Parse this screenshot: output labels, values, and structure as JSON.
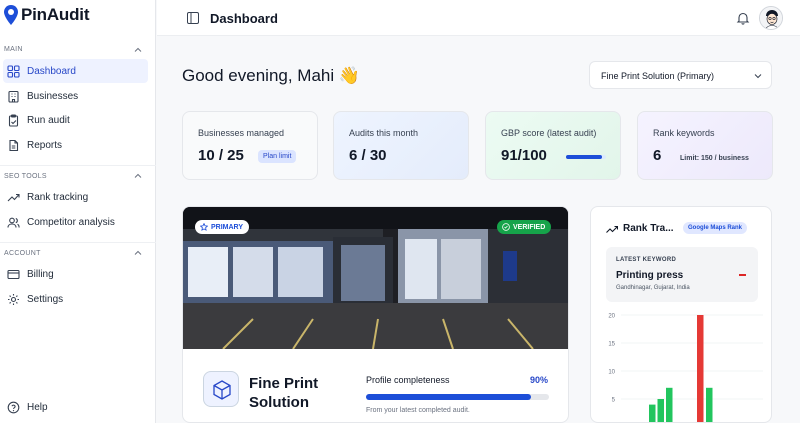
{
  "app": {
    "logo_text": "PinAudit"
  },
  "sidebar": {
    "sections": [
      {
        "label": "MAIN"
      },
      {
        "label": "SEO TOOLS"
      },
      {
        "label": "ACCOUNT"
      }
    ],
    "items": [
      {
        "label": "Dashboard",
        "icon": "grid-icon",
        "active": true
      },
      {
        "label": "Businesses",
        "icon": "building-icon"
      },
      {
        "label": "Run audit",
        "icon": "clipboard-icon"
      },
      {
        "label": "Reports",
        "icon": "file-icon"
      },
      {
        "label": "Rank tracking",
        "icon": "trend-up-icon"
      },
      {
        "label": "Competitor analysis",
        "icon": "users-icon"
      },
      {
        "label": "Billing",
        "icon": "card-icon"
      },
      {
        "label": "Settings",
        "icon": "gear-icon"
      },
      {
        "label": "Help",
        "icon": "help-icon"
      }
    ]
  },
  "topbar": {
    "title": "Dashboard"
  },
  "main": {
    "greeting": "Good evening, Mahi",
    "greeting_emoji": "👋",
    "business_select": {
      "value": "Fine Print Solution (Primary)"
    },
    "stats": [
      {
        "label": "Businesses managed",
        "value": "10 / 25",
        "pill": "Plan limit"
      },
      {
        "label": "Audits this month",
        "value": "6 / 30"
      },
      {
        "label": "GBP score (latest audit)",
        "value": "91/100",
        "progress": 0.91
      },
      {
        "label": "Rank keywords",
        "value": "6",
        "note": "Limit: 150 / business"
      }
    ],
    "business_card": {
      "badge_primary": "PRIMARY",
      "badge_verified": "VERIFIED",
      "name": "Fine Print Solution",
      "completeness_label": "Profile completeness",
      "completeness_pct": "90%",
      "completeness_value": 0.9,
      "completeness_note": "From your latest completed audit."
    },
    "rank_card": {
      "title": "Rank Tra...",
      "pill": "Google Maps Rank",
      "keyword_label": "LATEST KEYWORD",
      "keyword": "Printing press",
      "location": "Gandhinagar, Gujarat, India"
    }
  },
  "colors": {
    "accent": "#1d4ed8",
    "verified": "#16a34a",
    "bar_green": "#22c55e",
    "bar_red": "#e53935"
  },
  "chart_data": {
    "type": "bar",
    "y_ticks": [
      "20",
      "15",
      "10",
      "5"
    ],
    "ylim": [
      0,
      20
    ],
    "series": [
      {
        "color": "#22c55e",
        "values": [
          4,
          5,
          7
        ]
      },
      {
        "color": "#e53935",
        "values": [
          20
        ]
      },
      {
        "color": "#22c55e",
        "values": [
          7
        ]
      }
    ]
  }
}
